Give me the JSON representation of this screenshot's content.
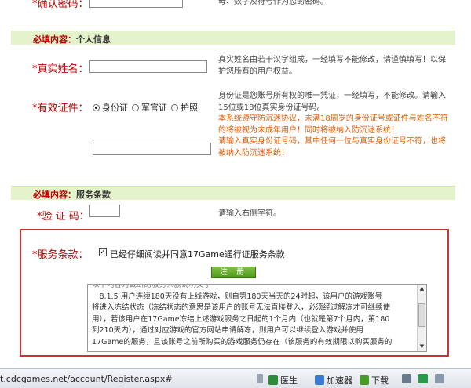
{
  "confirm_password": {
    "label": "确认密码：",
    "hint": "母、数字及符号作为您的密码。"
  },
  "section_personal": {
    "key": "必填内容：",
    "title": "个人信息"
  },
  "real_name": {
    "label": "真实姓名：",
    "hint_lines": [
      "真实姓名由若干汉字组成，一经填写不能修改，请谨慎填写！以保",
      "护您所有的用户权益。"
    ]
  },
  "id_doc": {
    "label": "有效证件：",
    "options": [
      "身份证",
      "军官证",
      "护照"
    ],
    "selected": "身份证",
    "hint_lines": [
      "身份证是您账号所有权的唯一凭证，一经填写，不能修改。请输入",
      "15位或18位真实身份证号码。"
    ],
    "warn_lines": [
      "本系统遵守防沉迷协议，未满18周岁的身份证号或证件与姓名不符",
      "的将被视为未成年用户！同时将被纳入防沉迷系统！",
      "请输入真实身份证号码，其中任何一位与真实身份证号不符，也将",
      "被纳入防沉迷系统！"
    ]
  },
  "section_terms": {
    "key": "必填内容：",
    "title": "服务条款"
  },
  "captcha": {
    "label": "验 证 码：",
    "hint": "请输入右侧字符。"
  },
  "terms": {
    "label": "服务条款：",
    "check_label": "已经仔细阅读并同意17Game通行证服务条款",
    "register_button": "注 册",
    "text_top": "以下内容为截断的服务条款说明文字",
    "text_lines": [
      "　8.1.5 用户连续180天没有上线游戏，则自第180天当天的24时起，该用户的游戏账号",
      "将进入冻结状态（冻结状态的意思是该用户的账号无法直接登入，必须经过解冻才可继续使",
      "用），若该用户在17Game冻结上述游戏服务之日起的1个月内（也就是第7个月内，第180",
      "到210天内），通过对应游戏的官方网站申请解冻，则用户可以继续登入游戏并使用",
      "17Game的服务，且该账号之前所购买的游戏服务仍存在（该服务的有效期限以购买服务的"
    ]
  },
  "statusbar": {
    "url": "t.cdcgames.net/account/Register.aspx#",
    "doctor": "医生",
    "accelerator": "加速器",
    "download": "下载"
  }
}
